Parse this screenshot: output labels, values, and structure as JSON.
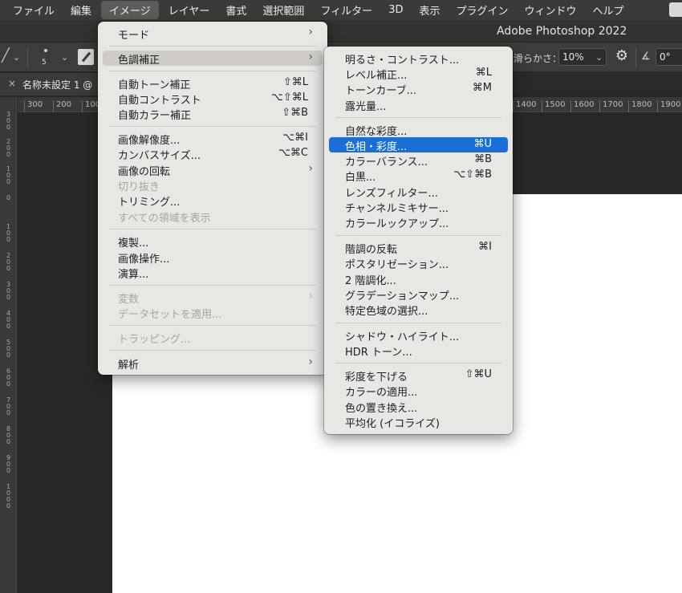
{
  "menubar": {
    "items": [
      "ファイル",
      "編集",
      "イメージ",
      "レイヤー",
      "書式",
      "選択範囲",
      "フィルター",
      "3D",
      "表示",
      "プラグイン",
      "ウィンドウ",
      "ヘルプ"
    ],
    "active_index": 2
  },
  "window": {
    "title": "Adobe Photoshop 2022"
  },
  "options_bar": {
    "brush_size": "5",
    "smoothing_label": "滑らかさ：",
    "smoothing_value": "10%",
    "angle_value": "0°",
    "icons": [
      "chevron-down-icon",
      "brush-mode-icon",
      "gear-icon",
      "angle-icon"
    ]
  },
  "document_tab": {
    "close_glyph": "×",
    "title": "名称未設定 1 @"
  },
  "ruler_top": [
    "300",
    "200",
    "100",
    "1400",
    "1500",
    "1600",
    "1700",
    "1800",
    "1900"
  ],
  "ruler_left": [
    "300",
    "200",
    "100",
    "0",
    "100",
    "200",
    "300",
    "400",
    "500",
    "600",
    "700",
    "800",
    "900",
    "1000"
  ],
  "image_menu": {
    "items": [
      {
        "label": "モード",
        "shortcut": "",
        "submenu": true,
        "disabled": false,
        "highlighted": false
      },
      {
        "label": "色調補正",
        "shortcut": "",
        "submenu": true,
        "disabled": false,
        "highlighted": true
      },
      {
        "label": "自動トーン補正",
        "shortcut": "⇧⌘L",
        "submenu": false,
        "disabled": false,
        "highlighted": false
      },
      {
        "label": "自動コントラスト",
        "shortcut": "⌥⇧⌘L",
        "submenu": false,
        "disabled": false,
        "highlighted": false
      },
      {
        "label": "自動カラー補正",
        "shortcut": "⇧⌘B",
        "submenu": false,
        "disabled": false,
        "highlighted": false
      },
      {
        "label": "画像解像度...",
        "shortcut": "⌥⌘I",
        "submenu": false,
        "disabled": false,
        "highlighted": false
      },
      {
        "label": "カンバスサイズ...",
        "shortcut": "⌥⌘C",
        "submenu": false,
        "disabled": false,
        "highlighted": false
      },
      {
        "label": "画像の回転",
        "shortcut": "",
        "submenu": true,
        "disabled": false,
        "highlighted": false
      },
      {
        "label": "切り抜き",
        "shortcut": "",
        "submenu": false,
        "disabled": true,
        "highlighted": false
      },
      {
        "label": "トリミング...",
        "shortcut": "",
        "submenu": false,
        "disabled": false,
        "highlighted": false
      },
      {
        "label": "すべての領域を表示",
        "shortcut": "",
        "submenu": false,
        "disabled": true,
        "highlighted": false
      },
      {
        "label": "複製...",
        "shortcut": "",
        "submenu": false,
        "disabled": false,
        "highlighted": false
      },
      {
        "label": "画像操作...",
        "shortcut": "",
        "submenu": false,
        "disabled": false,
        "highlighted": false
      },
      {
        "label": "演算...",
        "shortcut": "",
        "submenu": false,
        "disabled": false,
        "highlighted": false
      },
      {
        "label": "変数",
        "shortcut": "",
        "submenu": true,
        "disabled": true,
        "highlighted": false
      },
      {
        "label": "データセットを適用...",
        "shortcut": "",
        "submenu": false,
        "disabled": true,
        "highlighted": false
      },
      {
        "label": "トラッピング...",
        "shortcut": "",
        "submenu": false,
        "disabled": true,
        "highlighted": false
      },
      {
        "label": "解析",
        "shortcut": "",
        "submenu": true,
        "disabled": false,
        "highlighted": false
      }
    ]
  },
  "adjustments_menu": {
    "items": [
      {
        "label": "明るさ・コントラスト...",
        "shortcut": "",
        "highlighted": false
      },
      {
        "label": "レベル補正...",
        "shortcut": "⌘L",
        "highlighted": false
      },
      {
        "label": "トーンカーブ...",
        "shortcut": "⌘M",
        "highlighted": false
      },
      {
        "label": "露光量...",
        "shortcut": "",
        "highlighted": false
      },
      {
        "label": "自然な彩度...",
        "shortcut": "",
        "highlighted": false
      },
      {
        "label": "色相・彩度...",
        "shortcut": "⌘U",
        "highlighted": true
      },
      {
        "label": "カラーバランス...",
        "shortcut": "⌘B",
        "highlighted": false
      },
      {
        "label": "白黒...",
        "shortcut": "⌥⇧⌘B",
        "highlighted": false
      },
      {
        "label": "レンズフィルター...",
        "shortcut": "",
        "highlighted": false
      },
      {
        "label": "チャンネルミキサー...",
        "shortcut": "",
        "highlighted": false
      },
      {
        "label": "カラールックアップ...",
        "shortcut": "",
        "highlighted": false
      },
      {
        "label": "階調の反転",
        "shortcut": "⌘I",
        "highlighted": false
      },
      {
        "label": "ポスタリゼーション...",
        "shortcut": "",
        "highlighted": false
      },
      {
        "label": "2 階調化...",
        "shortcut": "",
        "highlighted": false
      },
      {
        "label": "グラデーションマップ...",
        "shortcut": "",
        "highlighted": false
      },
      {
        "label": "特定色域の選択...",
        "shortcut": "",
        "highlighted": false
      },
      {
        "label": "シャドウ・ハイライト...",
        "shortcut": "",
        "highlighted": false
      },
      {
        "label": "HDR トーン...",
        "shortcut": "",
        "highlighted": false
      },
      {
        "label": "彩度を下げる",
        "shortcut": "⇧⌘U",
        "highlighted": false
      },
      {
        "label": "カラーの適用...",
        "shortcut": "",
        "highlighted": false
      },
      {
        "label": "色の置き換え...",
        "shortcut": "",
        "highlighted": false
      },
      {
        "label": "平均化 (イコライズ)",
        "shortcut": "",
        "highlighted": false
      }
    ]
  },
  "colors": {
    "selection_blue": "#1a6fd6",
    "menu_bg": "#e9e7e4",
    "canvas": "#ffffff"
  }
}
